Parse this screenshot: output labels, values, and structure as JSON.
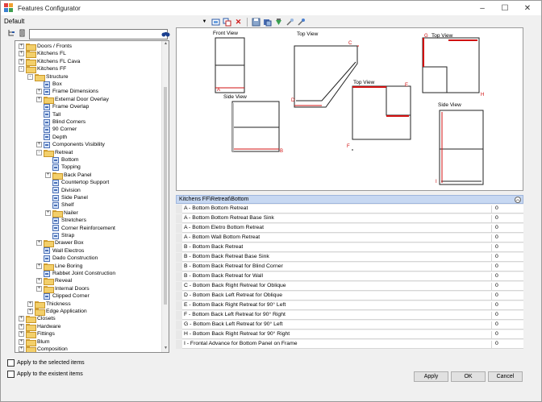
{
  "window": {
    "title": "Features Configurator"
  },
  "header": {
    "default_label": "Default"
  },
  "toolbar": {
    "icons": [
      "new-feature-icon",
      "copy-icon",
      "delete-icon",
      "save-icon",
      "export-icon",
      "import-icon",
      "tool-icon",
      "filter-icon"
    ]
  },
  "search": {
    "value": "",
    "placeholder": ""
  },
  "tree": [
    {
      "label": "Doors / Fronts",
      "level": 1,
      "expander": "+",
      "type": "folder"
    },
    {
      "label": "Kitchens FL",
      "level": 1,
      "expander": "+",
      "type": "folder"
    },
    {
      "label": "Kitchens FL Cava",
      "level": 1,
      "expander": "+",
      "type": "folder"
    },
    {
      "label": "Kitchens FF",
      "level": 1,
      "expander": "-",
      "type": "folder"
    },
    {
      "label": "Structure",
      "level": 2,
      "expander": "-",
      "type": "folder"
    },
    {
      "label": "Box",
      "level": 3,
      "expander": "",
      "type": "leaf"
    },
    {
      "label": "Frame Dimensions",
      "level": 3,
      "expander": "+",
      "type": "leaf"
    },
    {
      "label": "External Door Overlay",
      "level": 3,
      "expander": "+",
      "type": "folder"
    },
    {
      "label": "Frame Overlap",
      "level": 3,
      "expander": "",
      "type": "leaf"
    },
    {
      "label": "Tall",
      "level": 3,
      "expander": "",
      "type": "leaf"
    },
    {
      "label": "Blind Corners",
      "level": 3,
      "expander": "",
      "type": "leaf"
    },
    {
      "label": "90 Corner",
      "level": 3,
      "expander": "",
      "type": "leaf"
    },
    {
      "label": "Depth",
      "level": 3,
      "expander": "",
      "type": "leaf"
    },
    {
      "label": "Components Visibility",
      "level": 3,
      "expander": "+",
      "type": "leaf"
    },
    {
      "label": "Retreat",
      "level": 3,
      "expander": "-",
      "type": "folder"
    },
    {
      "label": "Bottom",
      "level": 4,
      "expander": "",
      "type": "leaf"
    },
    {
      "label": "Topping",
      "level": 4,
      "expander": "",
      "type": "leaf"
    },
    {
      "label": "Back Panel",
      "level": 4,
      "expander": "+",
      "type": "folder"
    },
    {
      "label": "Countertop Support",
      "level": 4,
      "expander": "",
      "type": "leaf"
    },
    {
      "label": "Division",
      "level": 4,
      "expander": "",
      "type": "leaf"
    },
    {
      "label": "Side Panel",
      "level": 4,
      "expander": "",
      "type": "leaf"
    },
    {
      "label": "Shelf",
      "level": 4,
      "expander": "",
      "type": "leaf"
    },
    {
      "label": "Nailer",
      "level": 4,
      "expander": "+",
      "type": "folder"
    },
    {
      "label": "Stretchers",
      "level": 4,
      "expander": "",
      "type": "leaf"
    },
    {
      "label": "Corner Reinforcement",
      "level": 4,
      "expander": "",
      "type": "leaf"
    },
    {
      "label": "Strap",
      "level": 4,
      "expander": "",
      "type": "leaf"
    },
    {
      "label": "Drawer Box",
      "level": 3,
      "expander": "+",
      "type": "folder"
    },
    {
      "label": "Wall Electros",
      "level": 3,
      "expander": "",
      "type": "leaf"
    },
    {
      "label": "Dado Construction",
      "level": 3,
      "expander": "",
      "type": "leaf"
    },
    {
      "label": "Line Boring",
      "level": 3,
      "expander": "+",
      "type": "folder"
    },
    {
      "label": "Rabbet Joint Construction",
      "level": 3,
      "expander": "",
      "type": "leaf"
    },
    {
      "label": "Reveal",
      "level": 3,
      "expander": "+",
      "type": "folder"
    },
    {
      "label": "Internal Doors",
      "level": 3,
      "expander": "+",
      "type": "folder"
    },
    {
      "label": "Clipped Corner",
      "level": 3,
      "expander": "",
      "type": "leaf"
    },
    {
      "label": "Thickness",
      "level": 2,
      "expander": "+",
      "type": "folder"
    },
    {
      "label": "Edge Application",
      "level": 2,
      "expander": "+",
      "type": "folder"
    },
    {
      "label": "Closets",
      "level": 1,
      "expander": "+",
      "type": "folder"
    },
    {
      "label": "Hardware",
      "level": 1,
      "expander": "+",
      "type": "folder"
    },
    {
      "label": "Fittings",
      "level": 1,
      "expander": "+",
      "type": "folder"
    },
    {
      "label": "Blum",
      "level": 1,
      "expander": "+",
      "type": "folder"
    },
    {
      "label": "Composition",
      "level": 1,
      "expander": "+",
      "type": "folder"
    }
  ],
  "options": {
    "apply_selected": "Apply to the selected items",
    "apply_existent": "Apply to the existent items"
  },
  "preview": {
    "labels": {
      "front_view": "Front View",
      "side_view_1": "Side View",
      "top_view_1": "Top View",
      "top_view_2": "Top View",
      "top_view_3": "Top View",
      "side_view_2": "Side View"
    },
    "markers": {
      "a": "A",
      "b": "B",
      "c": "C",
      "d": "D",
      "e": "E",
      "f": "F",
      "g": "G",
      "h": "H",
      "i": "I"
    }
  },
  "properties": {
    "path": "Kitchens FF\\Retreat\\Bottom",
    "rows": [
      {
        "name": "A - Bottom Bottom Retreat",
        "value": "0"
      },
      {
        "name": "A - Bottom Bottom Retreat Base Sink",
        "value": "0"
      },
      {
        "name": "A - Bottom Eletro Bottom Retreat",
        "value": "0"
      },
      {
        "name": "A - Bottom Wall Bottom Retreat",
        "value": "0"
      },
      {
        "name": "B - Bottom Back Retreat",
        "value": "0"
      },
      {
        "name": "B - Bottom Back Retreat Base Sink",
        "value": "0"
      },
      {
        "name": "B - Bottom Back Retreat for Blind Corner",
        "value": "0"
      },
      {
        "name": "B - Bottom Back Retreat for Wall",
        "value": "0"
      },
      {
        "name": "C - Bottom Back Right Retreat for Oblique",
        "value": "0"
      },
      {
        "name": "D - Bottom Back Left Retreat for Oblique",
        "value": "0"
      },
      {
        "name": "E - Bottom Back Right Retreat for 90° Left",
        "value": "0"
      },
      {
        "name": "F - Bottom Back Left Retreat for 90° Right",
        "value": "0"
      },
      {
        "name": "G - Bottom Back Left Retreat for 90° Left",
        "value": "0"
      },
      {
        "name": "H - Bottom Back Right Retreat for 90° Right",
        "value": "0"
      },
      {
        "name": "I - Frontal Advance for Bottom Panel on Frame",
        "value": "0"
      }
    ]
  },
  "buttons": {
    "apply": "Apply",
    "ok": "OK",
    "cancel": "Cancel"
  }
}
